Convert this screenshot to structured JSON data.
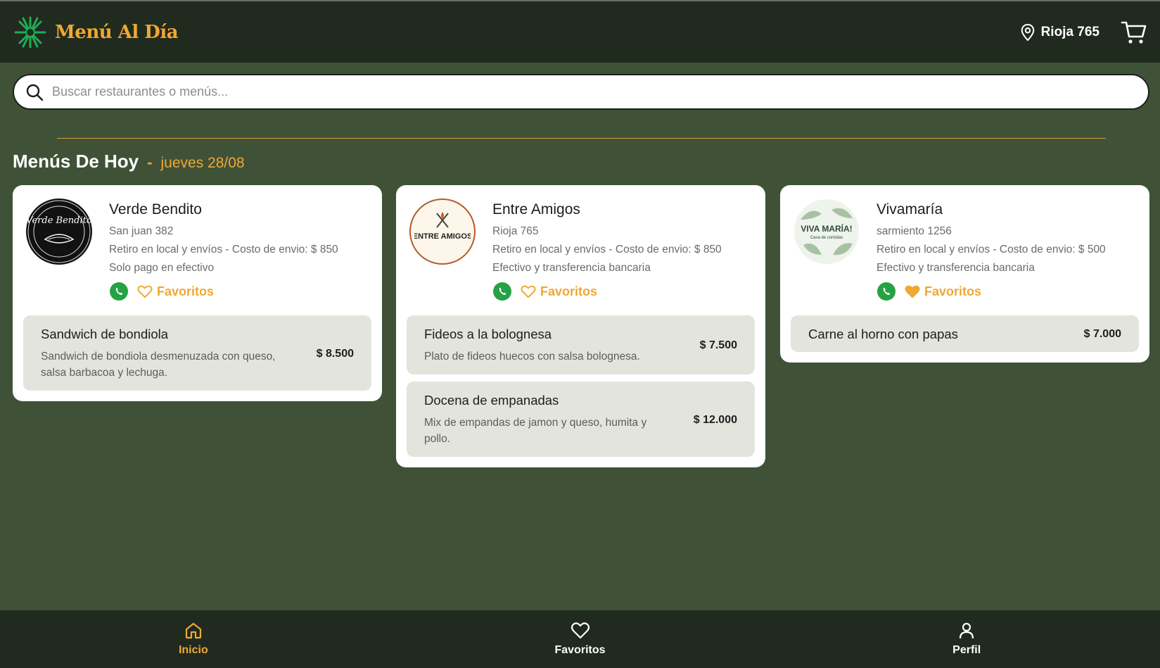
{
  "header": {
    "brand_name": "Menú Al Día",
    "location": "Rioja 765"
  },
  "search": {
    "placeholder": "Buscar restaurantes o menús..."
  },
  "section": {
    "title": "Menús De Hoy",
    "separator": "-",
    "date": "jueves 28/08"
  },
  "restaurants": [
    {
      "name": "Verde Bendito",
      "address": "San juan 382",
      "delivery": "Retiro en local y envíos - Costo de envio: $ 850",
      "payment": "Solo pago en efectivo",
      "favorite_label": "Favoritos",
      "favorite": false,
      "logo_lettering": "Verde Bendito",
      "menu": [
        {
          "name": "Sandwich de bondiola",
          "description": "Sandwich de bondiola desmenuzada con queso, salsa barbacoa y lechuga.",
          "price": "$ 8.500"
        }
      ]
    },
    {
      "name": "Entre Amigos",
      "address": "Rioja 765",
      "delivery": "Retiro en local y envíos - Costo de envio: $ 850",
      "payment": "Efectivo y transferencia bancaria",
      "favorite_label": "Favoritos",
      "favorite": false,
      "logo_lettering": "ENTRE AMIGOS",
      "menu": [
        {
          "name": "Fideos a la bolognesa",
          "description": "Plato de fideos huecos con salsa bolognesa.",
          "price": "$ 7.500"
        },
        {
          "name": "Docena de empanadas",
          "description": "Mix de empandas de jamon y queso, humita y pollo.",
          "price": "$ 12.000"
        }
      ]
    },
    {
      "name": "Vivamaría",
      "address": "sarmiento 1256",
      "delivery": "Retiro en local y envíos - Costo de envio: $ 500",
      "payment": "Efectivo y transferencia bancaria",
      "favorite_label": "Favoritos",
      "favorite": true,
      "logo_lettering": "VIVA MARÍA!",
      "logo_sub": "Casa de comidas",
      "menu": [
        {
          "name": "Carne al horno con papas",
          "description": "",
          "price": "$ 7.000"
        }
      ]
    }
  ],
  "bottom_nav": {
    "items": [
      {
        "label": "Inicio",
        "icon": "home-icon",
        "active": true
      },
      {
        "label": "Favoritos",
        "icon": "heart-icon",
        "active": false
      },
      {
        "label": "Perfil",
        "icon": "user-icon",
        "active": false
      }
    ]
  },
  "colors": {
    "accent": "#f0a832",
    "background": "#3f5237",
    "header": "#212a1f",
    "menu_item_bg": "#e3e5dc",
    "whatsapp": "#25a244"
  }
}
